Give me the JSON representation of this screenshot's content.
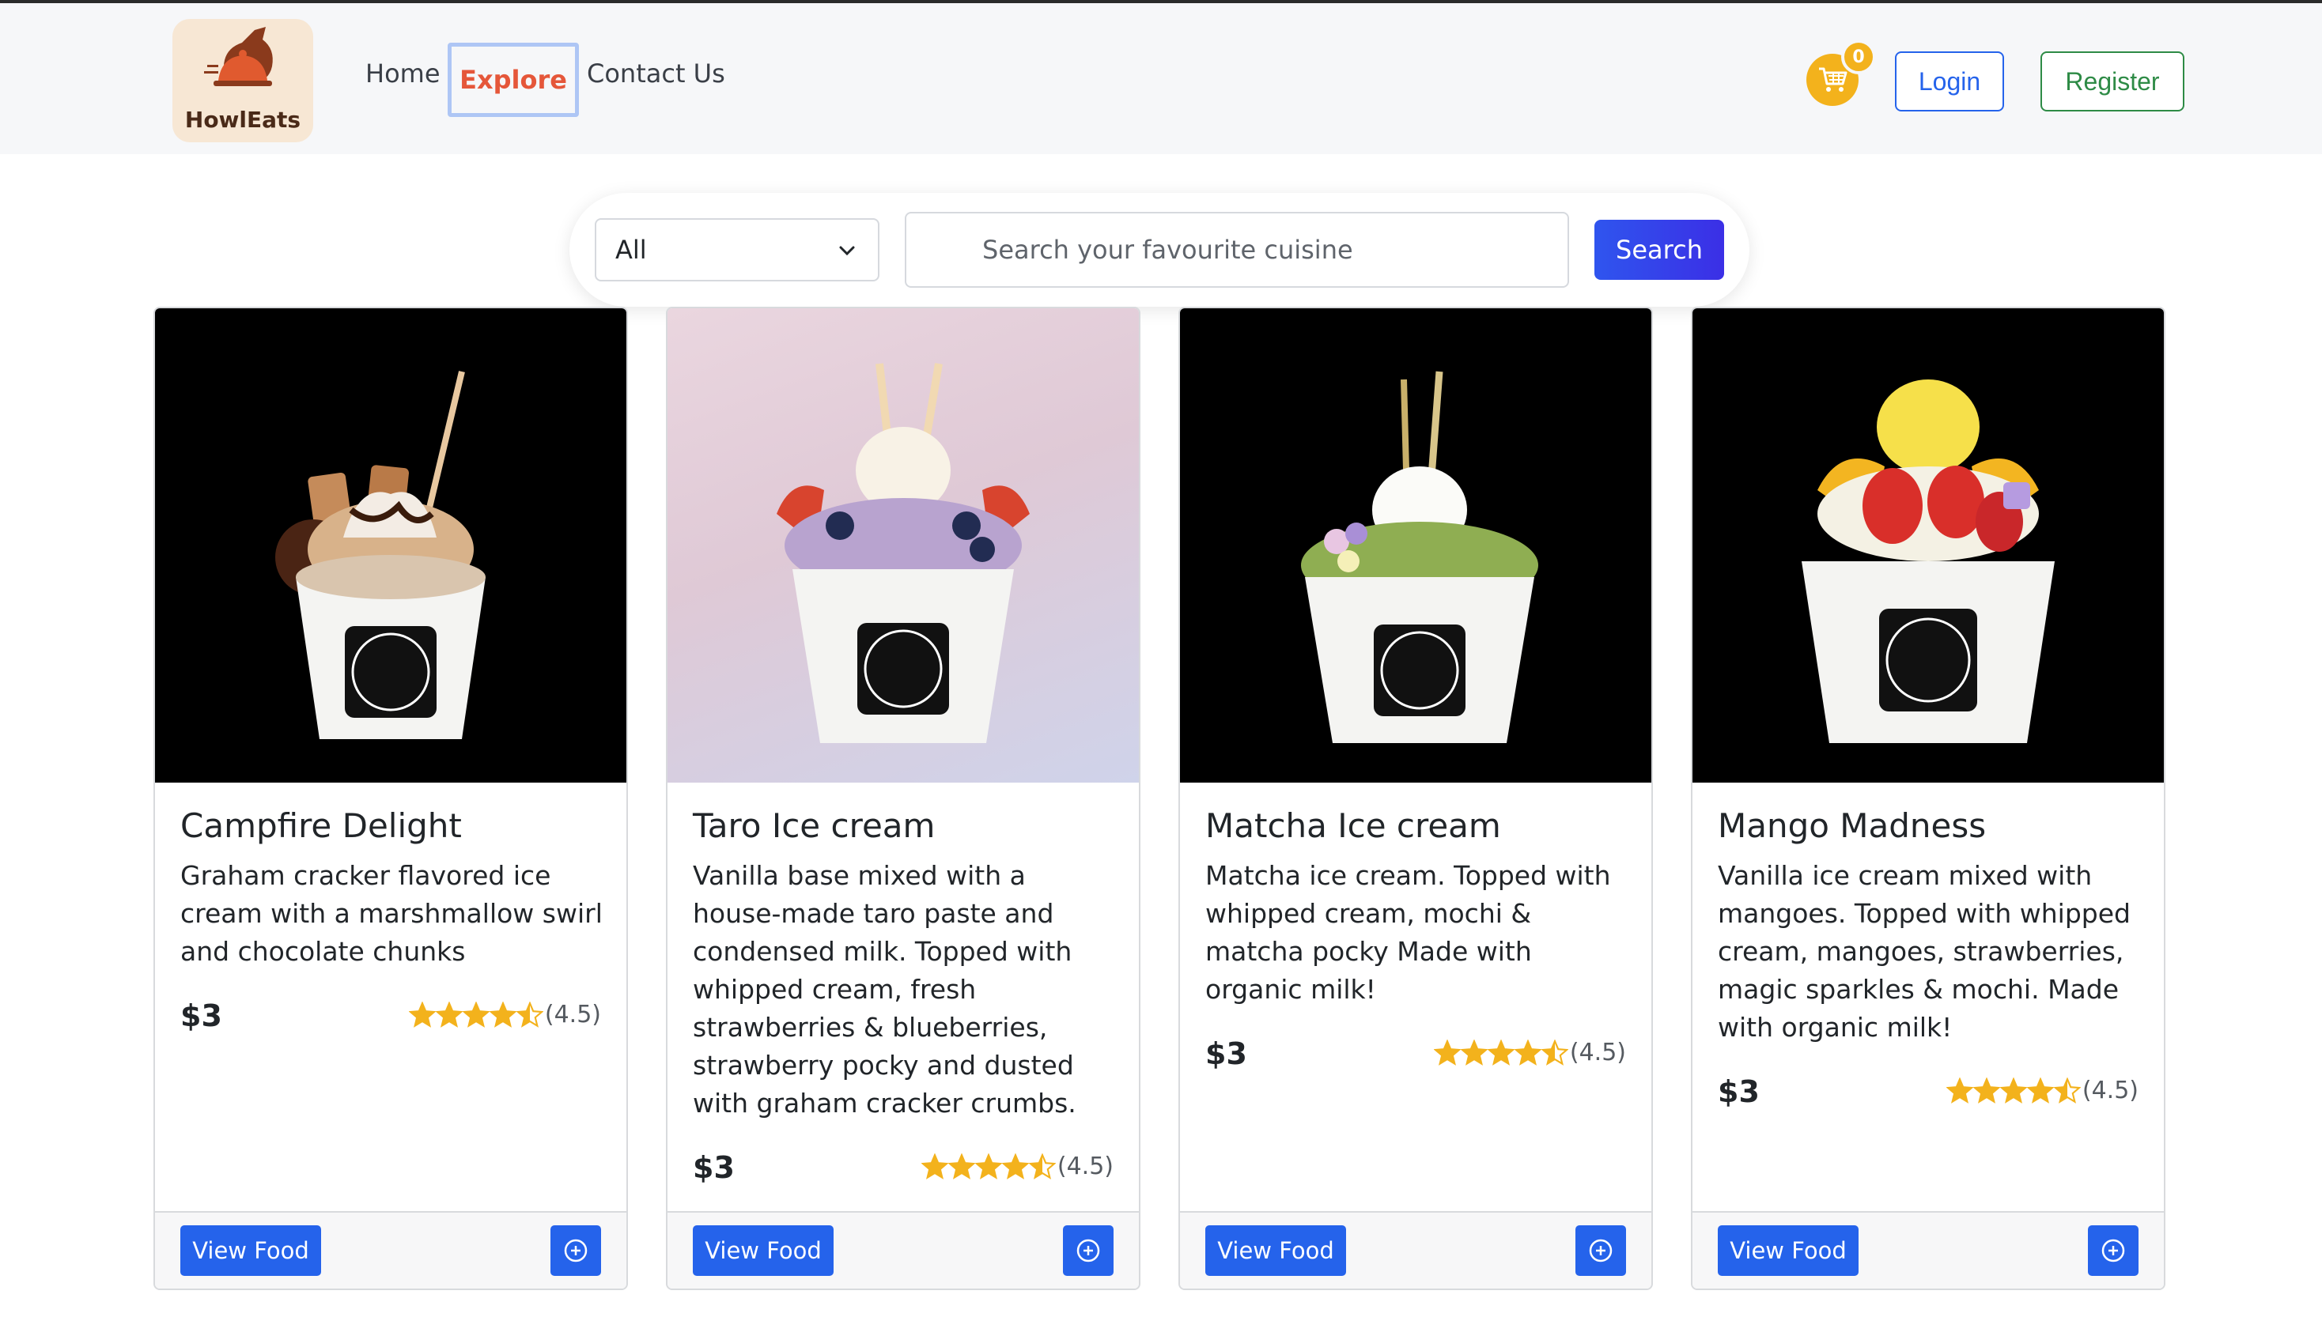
{
  "brand": {
    "name": "HowlEats"
  },
  "nav": {
    "home": "Home",
    "explore": "Explore",
    "contact": "Contact Us"
  },
  "cart": {
    "count": "0",
    "icon": "cart-icon"
  },
  "auth": {
    "login": "Login",
    "register": "Register"
  },
  "search": {
    "category_selected": "All",
    "placeholder": "Search your favourite cuisine",
    "button": "Search"
  },
  "colors": {
    "accent": "#2563eb",
    "explore_active": "#e5573a",
    "register_green": "#2e8b46",
    "star": "#f3b21c",
    "cart": "#f3b21c"
  },
  "cards": [
    {
      "title": "Campfire Delight",
      "description": "Graham cracker flavored ice cream with a marshmallow swirl and chocolate chunks",
      "price": "$3",
      "rating": "(4.5)",
      "rating_value": 4.5,
      "view_label": "View Food"
    },
    {
      "title": "Taro Ice cream",
      "description": "Vanilla base mixed with a house-made taro paste and condensed milk. Topped with whipped cream, fresh strawberries & blueberries, strawberry pocky and dusted with graham cracker crumbs.",
      "price": "$3",
      "rating": "(4.5)",
      "rating_value": 4.5,
      "view_label": "View Food"
    },
    {
      "title": "Matcha Ice cream",
      "description": "Matcha ice cream. Topped with whipped cream, mochi & matcha pocky Made with organic milk!",
      "price": "$3",
      "rating": "(4.5)",
      "rating_value": 4.5,
      "view_label": "View Food"
    },
    {
      "title": "Mango Madness",
      "description": "Vanilla ice cream mixed with mangoes. Topped with whipped cream, mangoes, strawberries, magic sparkles & mochi. Made with organic milk!",
      "price": "$3",
      "rating": "(4.5)",
      "rating_value": 4.5,
      "view_label": "View Food"
    }
  ]
}
